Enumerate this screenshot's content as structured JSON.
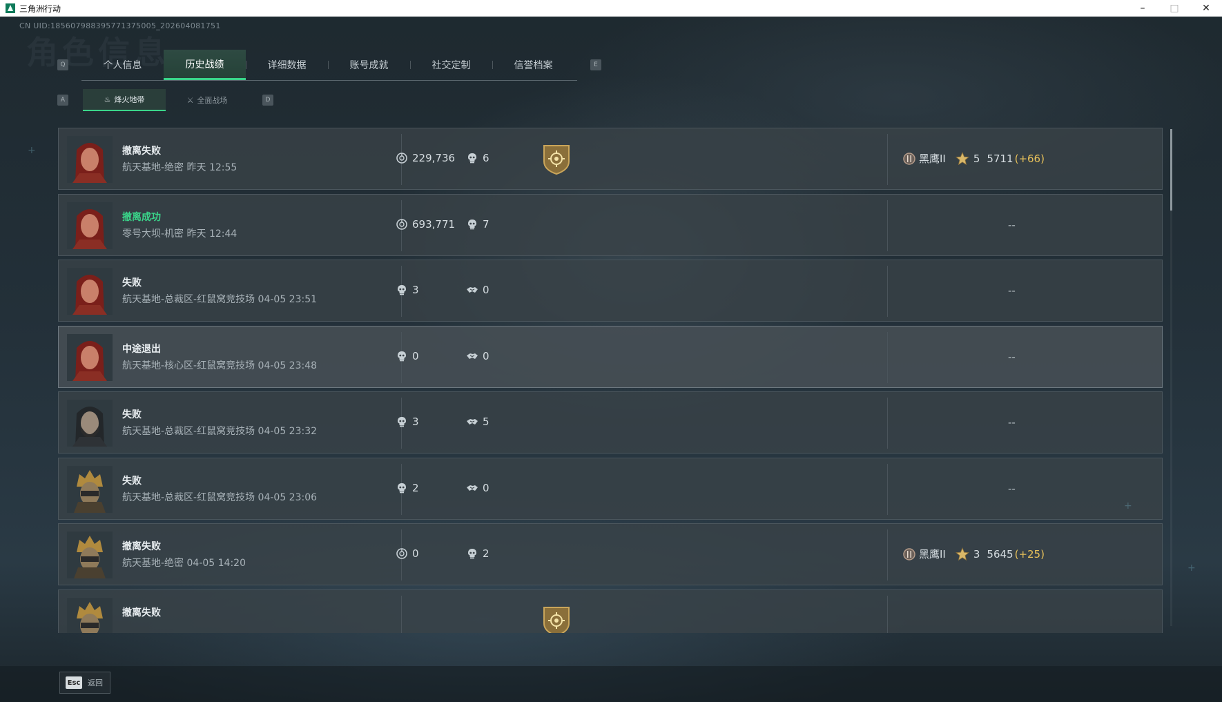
{
  "window": {
    "title": "三角洲行动"
  },
  "uid": "CN UID:18560798839577137500​5_202604081751",
  "ghost_title": "角色信息",
  "tabs": [
    {
      "label": "个人信息",
      "active": false
    },
    {
      "label": "历史战绩",
      "active": true
    },
    {
      "label": "详细数据",
      "active": false
    },
    {
      "label": "账号成就",
      "active": false
    },
    {
      "label": "社交定制",
      "active": false
    },
    {
      "label": "信誉档案",
      "active": false
    }
  ],
  "tab_keys": {
    "prev": "Q",
    "next": "E"
  },
  "subtab_keys": {
    "prev": "A",
    "next": "D"
  },
  "subtabs": [
    {
      "label": "烽火地带",
      "icon": "flame-icon",
      "active": true
    },
    {
      "label": "全面战场",
      "icon": "battlefield-icon",
      "active": false
    }
  ],
  "records": [
    {
      "result": "撤离失败",
      "status": "fail",
      "map": "航天基地-绝密 昨天 12:55",
      "mode": "extract",
      "value": "229,736",
      "kills": "6",
      "badge": true,
      "avatar": "red-hair",
      "rank": {
        "name": "黑鹰II",
        "stars": "5",
        "score": "5711",
        "delta": "(+66)"
      }
    },
    {
      "result": "撤离成功",
      "status": "success",
      "map": "零号大坝-机密 昨天 12:44",
      "mode": "extract",
      "value": "693,771",
      "kills": "7",
      "badge": false,
      "avatar": "red-hair",
      "rank": null
    },
    {
      "result": "失败",
      "status": "fail",
      "map": "航天基地-总裁区-红鼠窝竞技场 04-05 23:51",
      "mode": "arena",
      "kills": "3",
      "assists": "0",
      "avatar": "red-hair",
      "rank": null
    },
    {
      "result": "中途退出",
      "status": "fail",
      "map": "航天基地-核心区-红鼠窝竞技场 04-05 23:48",
      "mode": "arena",
      "kills": "0",
      "assists": "0",
      "avatar": "red-hair",
      "rank": null,
      "highlight": true
    },
    {
      "result": "失败",
      "status": "fail",
      "map": "航天基地-总裁区-红鼠窝竞技场 04-05 23:32",
      "mode": "arena",
      "kills": "3",
      "assists": "5",
      "avatar": "bearded",
      "rank": null
    },
    {
      "result": "失败",
      "status": "fail",
      "map": "航天基地-总裁区-红鼠窝竞技场 04-05 23:06",
      "mode": "arena",
      "kills": "2",
      "assists": "0",
      "avatar": "helmet",
      "rank": null
    },
    {
      "result": "撤离失败",
      "status": "fail",
      "map": "航天基地-绝密 04-05 14:20",
      "mode": "extract",
      "value": "0",
      "kills": "2",
      "badge": false,
      "avatar": "helmet",
      "rank": {
        "name": "黑鹰II",
        "stars": "3",
        "score": "5645",
        "delta": "(+25)"
      }
    },
    {
      "result": "撤离失败",
      "status": "fail",
      "map": "",
      "mode": "extract",
      "value": "",
      "kills": "",
      "badge": true,
      "avatar": "helmet",
      "rank": null,
      "partial": true
    }
  ],
  "empty_rank": "--",
  "footer": {
    "esc_key": "Esc",
    "esc_label": "返回"
  },
  "colors": {
    "accent": "#3ad58a",
    "delta": "#e8c15a"
  }
}
